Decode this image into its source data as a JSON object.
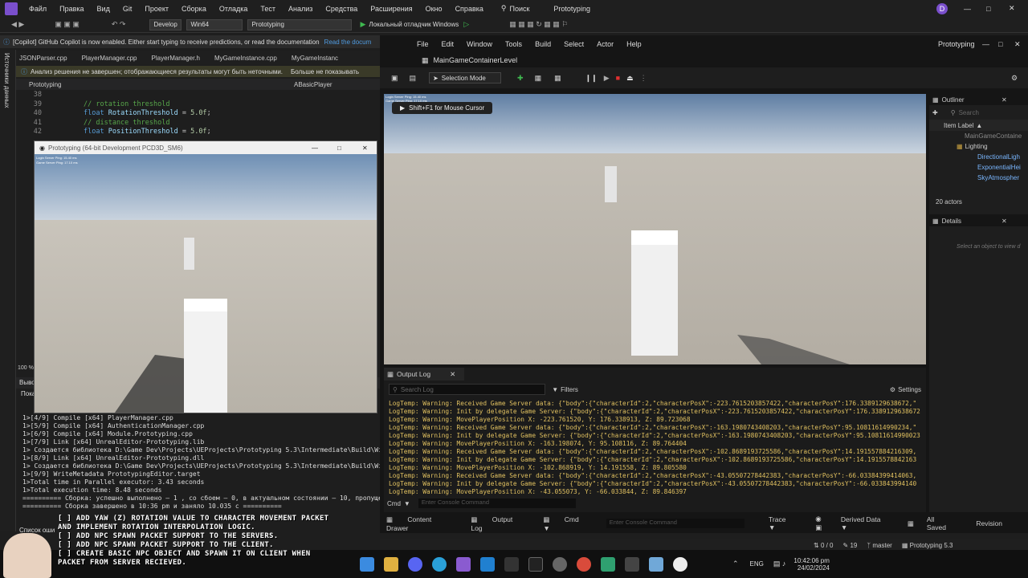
{
  "vs": {
    "menu": [
      "Файл",
      "Правка",
      "Вид",
      "Git",
      "Проект",
      "Сборка",
      "Отладка",
      "Тест",
      "Анализ",
      "Средства",
      "Расширения",
      "Окно",
      "Справка"
    ],
    "search": "Поиск",
    "solution": "Prototyping",
    "avatar": "D",
    "config": "Develop",
    "platform": "Win64",
    "project": "Prototyping",
    "debugger": "Локальный отладчик Windows",
    "copilot_msg": "[Copilot] GitHub Copilot is now enabled. Either start typing to receive predictions, or read the documentation",
    "copilot_link": "Read the docum",
    "tabs": [
      "JSONParser.cpp",
      "PlayerManager.cpp",
      "PlayerManager.h",
      "MyGameInstance.cpp",
      "MyGameInstanc"
    ],
    "analysis_msg": "Анализ решения не завершен; отображающиеся результаты могут быть неточными.",
    "analysis_link": "Больше не показывать",
    "nav_left": "Prototyping",
    "nav_right": "ABasicPlayer",
    "side_label": "Источники данных",
    "code": [
      {
        "ln": "38",
        "text": ""
      },
      {
        "ln": "39",
        "text": "// rotation threshold",
        "cls": "cm"
      },
      {
        "ln": "40",
        "kw": "float",
        "id": "RotationThreshold",
        "rest": " = ",
        "num": "5.0f",
        "end": ";"
      },
      {
        "ln": "41",
        "text": "// distance threshold",
        "cls": "cm"
      },
      {
        "ln": "42",
        "kw": "float",
        "id": "PositionThreshold",
        "rest": " = ",
        "num": "5.0f",
        "end": ";"
      }
    ],
    "zoom": "100 %",
    "output_header": "Выво",
    "output_show": "Пока",
    "output_lines": [
      "1>[4/9] Compile [x64] PlayerManager.cpp",
      "1>[5/9] Compile [x64] AuthenticationManager.cpp",
      "1>[6/9] Compile [x64] Module.Prototyping.cpp",
      "1>[7/9] Link [x64] UnrealEditor-Prototyping.lib",
      "1>   Создается библиотека D:\\Game Dev\\Projects\\UEProjects\\Prototyping 5.3\\Intermediate\\Build\\Wi",
      "1>[8/9] Link [x64] UnrealEditor-Prototyping.dll",
      "1>   Создается библиотека D:\\Game Dev\\Projects\\UEProjects\\Prototyping 5.3\\Intermediate\\Build\\Wi",
      "1>[9/9] WriteMetadata PrototypingEditor.target",
      "1>Total time in Parallel executor: 3.43 seconds",
      "1>Total execution time: 8.48 seconds",
      "========== Сборка: успешно выполнено — 1 , со сбоем — 0, в актуальном состоянии — 10, пропущено",
      "========== Сборка завершено в 10:36 pm и заняло 10.035 с =========="
    ],
    "errors_label": "Список оши"
  },
  "game": {
    "title": "Prototyping (64-bit Development PCD3D_SM6)",
    "ping1": "Login Server Ping: 15.40 ms",
    "ping2": "Game Server Ping: 17.10 ms"
  },
  "ue": {
    "menu": [
      "File",
      "Edit",
      "Window",
      "Tools",
      "Build",
      "Select",
      "Actor",
      "Help"
    ],
    "project": "Prototyping",
    "level": "MainGameContainerLevel",
    "mode": "Selection Mode",
    "hint": "Shift+F1 for Mouse Cursor",
    "outliner_title": "Outliner",
    "search_ph": "Search",
    "item_label": "Item Label",
    "tree": [
      "MainGameContaine",
      "Lighting",
      "DirectionalLigh",
      "ExponentialHei",
      "SkyAtmospher"
    ],
    "actors": "20 actors",
    "details_title": "Details",
    "details_hint": "Select an object to view d",
    "outlog_title": "Output Log",
    "outlog_search": "Search Log",
    "filters": "Filters",
    "settings": "Settings",
    "log": [
      "LogTemp: Warning: Received Game Server data: {\"body\":{\"characterId\":2,\"characterPosX\":-223.7615203857422,\"characterPosY\":176.3389129638672,\"",
      "LogTemp: Warning: Init by delegate Game Server: {\"body\":{\"characterId\":2,\"characterPosX\":-223.7615203857422,\"characterPosY\":176.3389129638672",
      "LogTemp: Warning: MovePlayerPosition X: -223.761520, Y: 176.338913, Z: 89.723068",
      "LogTemp: Warning: Received Game Server data: {\"body\":{\"characterId\":2,\"characterPosX\":-163.1980743408203,\"characterPosY\":95.10811614990234,\"",
      "LogTemp: Warning: Init by delegate Game Server: {\"body\":{\"characterId\":2,\"characterPosX\":-163.1980743408203,\"characterPosY\":95.10811614990023",
      "LogTemp: Warning: MovePlayerPosition X: -163.198074, Y: 95.108116, Z: 89.764404",
      "LogTemp: Warning: Received Game Server data: {\"body\":{\"characterId\":2,\"characterPosX\":-102.8689193725586,\"characterPosY\":14.191557884216309,",
      "LogTemp: Warning: Init by delegate Game Server: {\"body\":{\"characterId\":2,\"characterPosX\":-102.8689193725586,\"characterPosY\":14.1915578842163",
      "LogTemp: Warning: MovePlayerPosition X: -102.868919, Y: 14.191558, Z: 89.805580",
      "LogTemp: Warning: Received Game Server data: {\"body\":{\"characterId\":2,\"characterPosX\":-43.05507278442383,\"characterPosY\":-66.03384399414063,",
      "LogTemp: Warning: Init by delegate Game Server: {\"body\":{\"characterId\":2,\"characterPosX\":-43.05507278442383,\"characterPosY\":-66.033843994140",
      "LogTemp: Warning: MovePlayerPosition X: -43.055073, Y: -66.033844, Z: 89.846397"
    ],
    "cmd": "Cmd",
    "console_ph": "Enter Console Command",
    "bottom": {
      "content_drawer": "Content Drawer",
      "output_log": "Output Log",
      "cmd": "Cmd",
      "trace": "Trace",
      "derived": "Derived Data",
      "saved": "All Saved",
      "revision": "Revision"
    }
  },
  "status": {
    "git": "0 / 0",
    "changes": "19",
    "branch": "master",
    "project": "Prototyping 5.3"
  },
  "overlay": [
    "[ ] ADD YAW (Z) ROTATION VALUE TO CHARACTER MOVEMENT PACKET",
    "AND IMPLEMENT ROTATION INTERPOLATION LOGIC.",
    "[ ] ADD NPC SPAWN PACKET SUPPORT TO THE SERVERS.",
    "[ ] ADD NPC SPAWN PACKET SUPPORT TO THE CLIENT.",
    "[ ] CREATE BASIC NPC OBJECT AND SPAWN IT ON CLIENT WHEN",
    "PACKET FROM SERVER RECIEVED."
  ],
  "taskbar": {
    "lang": "ENG",
    "time": "10:42:06 pm",
    "date": "24/02/2024"
  }
}
